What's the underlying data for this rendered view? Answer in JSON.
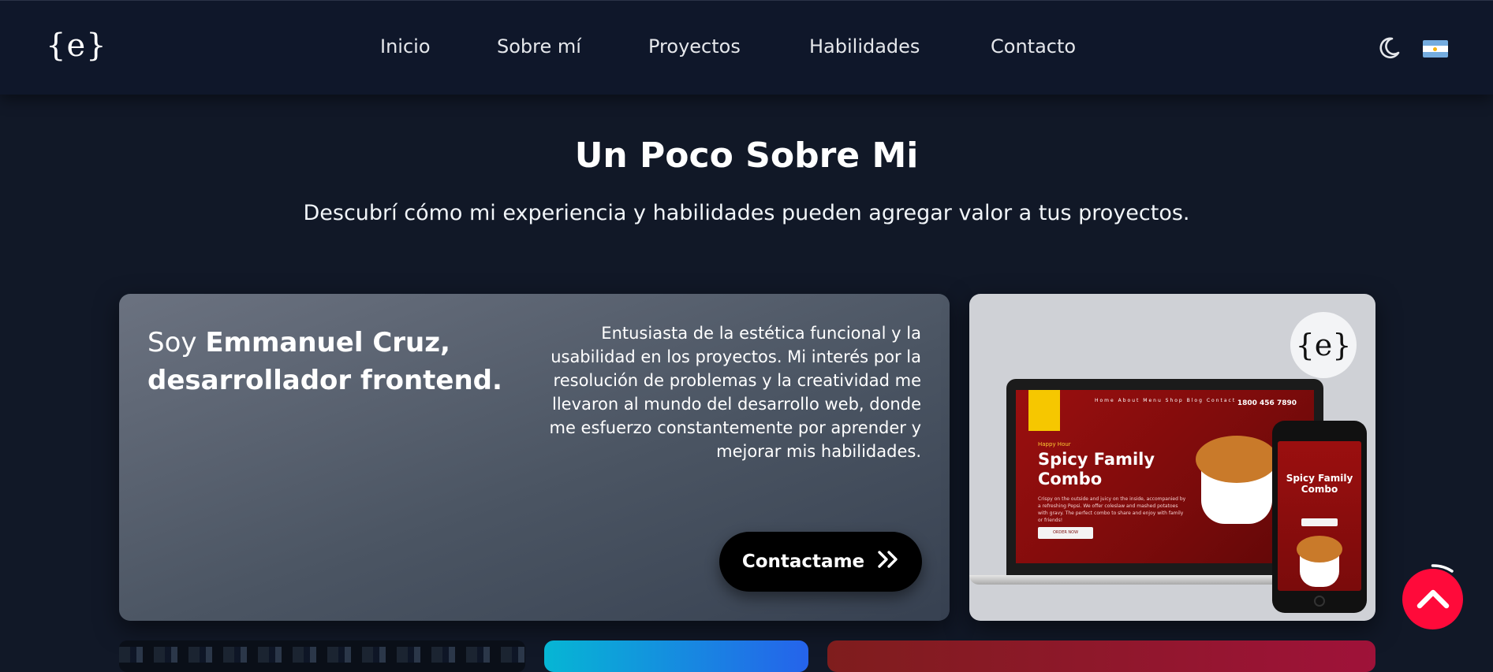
{
  "header": {
    "logo": "{e}",
    "nav": [
      {
        "label": "Inicio"
      },
      {
        "label": "Sobre mí"
      },
      {
        "label": "Proyectos"
      },
      {
        "label": "Habilidades"
      },
      {
        "label": "Contacto"
      }
    ],
    "theme_icon": "moon-icon",
    "language_icon": "argentina-flag-icon"
  },
  "section": {
    "title": "Un Poco Sobre Mi",
    "subtitle": "Descubrí cómo mi experiencia y habilidades pueden agregar valor a tus proyectos."
  },
  "about": {
    "intro_prefix": "Soy",
    "intro_name": "Emmanuel Cruz,",
    "intro_role": "desarrollador frontend.",
    "bio": "Entusiasta de la estética funcional y la usabilidad en los proyectos. Mi interés por la resolución de problemas y la creatividad me llevaron al mundo del desarrollo web, donde me esfuerzo constantemente por aprender y mejorar mis habilidades.",
    "contact_label": "Contactame",
    "contact_icon": "double-chevron-right-icon"
  },
  "showcase": {
    "badge": "{e}",
    "site_nav": "Home  About  Menu  Shop  Blog  Contact",
    "site_phone": "1800 456 7890",
    "site_tag": "Happy Hour",
    "site_title": "Spicy Family Combo",
    "site_text": "Crispy on the outside and juicy on the inside, accompanied by a refreshing Pepsi. We offer coleslaw and mashed potatoes with gravy. The perfect combo to share and enjoy with family or friends!",
    "site_button": "ORDER NOW",
    "phone_title": "Spicy Family Combo"
  },
  "scroll_top_icon": "chevron-up-icon",
  "colors": {
    "background": "#111827",
    "header": "#0f172a",
    "accent": "#ff0a3a",
    "button": "#000000"
  }
}
